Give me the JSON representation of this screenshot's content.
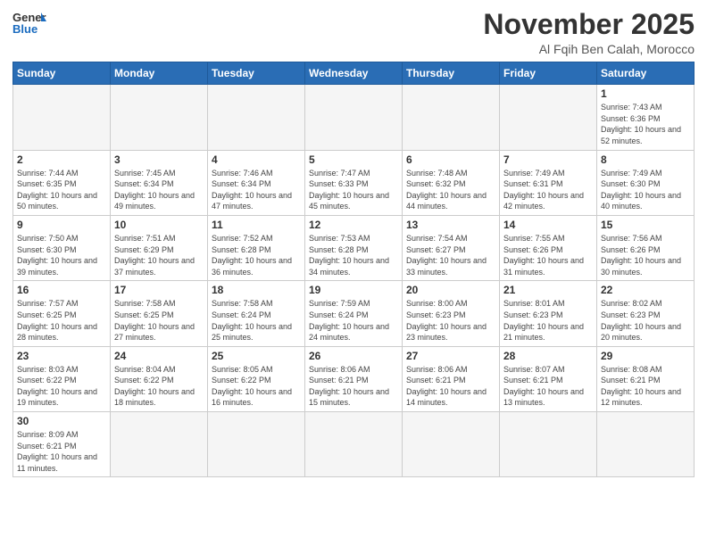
{
  "logo": {
    "text_general": "General",
    "text_blue": "Blue"
  },
  "header": {
    "title": "November 2025",
    "subtitle": "Al Fqih Ben Calah, Morocco"
  },
  "weekdays": [
    "Sunday",
    "Monday",
    "Tuesday",
    "Wednesday",
    "Thursday",
    "Friday",
    "Saturday"
  ],
  "weeks": [
    [
      {
        "day": "",
        "info": ""
      },
      {
        "day": "",
        "info": ""
      },
      {
        "day": "",
        "info": ""
      },
      {
        "day": "",
        "info": ""
      },
      {
        "day": "",
        "info": ""
      },
      {
        "day": "",
        "info": ""
      },
      {
        "day": "1",
        "info": "Sunrise: 7:43 AM\nSunset: 6:36 PM\nDaylight: 10 hours and 52 minutes."
      }
    ],
    [
      {
        "day": "2",
        "info": "Sunrise: 7:44 AM\nSunset: 6:35 PM\nDaylight: 10 hours and 50 minutes."
      },
      {
        "day": "3",
        "info": "Sunrise: 7:45 AM\nSunset: 6:34 PM\nDaylight: 10 hours and 49 minutes."
      },
      {
        "day": "4",
        "info": "Sunrise: 7:46 AM\nSunset: 6:34 PM\nDaylight: 10 hours and 47 minutes."
      },
      {
        "day": "5",
        "info": "Sunrise: 7:47 AM\nSunset: 6:33 PM\nDaylight: 10 hours and 45 minutes."
      },
      {
        "day": "6",
        "info": "Sunrise: 7:48 AM\nSunset: 6:32 PM\nDaylight: 10 hours and 44 minutes."
      },
      {
        "day": "7",
        "info": "Sunrise: 7:49 AM\nSunset: 6:31 PM\nDaylight: 10 hours and 42 minutes."
      },
      {
        "day": "8",
        "info": "Sunrise: 7:49 AM\nSunset: 6:30 PM\nDaylight: 10 hours and 40 minutes."
      }
    ],
    [
      {
        "day": "9",
        "info": "Sunrise: 7:50 AM\nSunset: 6:30 PM\nDaylight: 10 hours and 39 minutes."
      },
      {
        "day": "10",
        "info": "Sunrise: 7:51 AM\nSunset: 6:29 PM\nDaylight: 10 hours and 37 minutes."
      },
      {
        "day": "11",
        "info": "Sunrise: 7:52 AM\nSunset: 6:28 PM\nDaylight: 10 hours and 36 minutes."
      },
      {
        "day": "12",
        "info": "Sunrise: 7:53 AM\nSunset: 6:28 PM\nDaylight: 10 hours and 34 minutes."
      },
      {
        "day": "13",
        "info": "Sunrise: 7:54 AM\nSunset: 6:27 PM\nDaylight: 10 hours and 33 minutes."
      },
      {
        "day": "14",
        "info": "Sunrise: 7:55 AM\nSunset: 6:26 PM\nDaylight: 10 hours and 31 minutes."
      },
      {
        "day": "15",
        "info": "Sunrise: 7:56 AM\nSunset: 6:26 PM\nDaylight: 10 hours and 30 minutes."
      }
    ],
    [
      {
        "day": "16",
        "info": "Sunrise: 7:57 AM\nSunset: 6:25 PM\nDaylight: 10 hours and 28 minutes."
      },
      {
        "day": "17",
        "info": "Sunrise: 7:58 AM\nSunset: 6:25 PM\nDaylight: 10 hours and 27 minutes."
      },
      {
        "day": "18",
        "info": "Sunrise: 7:58 AM\nSunset: 6:24 PM\nDaylight: 10 hours and 25 minutes."
      },
      {
        "day": "19",
        "info": "Sunrise: 7:59 AM\nSunset: 6:24 PM\nDaylight: 10 hours and 24 minutes."
      },
      {
        "day": "20",
        "info": "Sunrise: 8:00 AM\nSunset: 6:23 PM\nDaylight: 10 hours and 23 minutes."
      },
      {
        "day": "21",
        "info": "Sunrise: 8:01 AM\nSunset: 6:23 PM\nDaylight: 10 hours and 21 minutes."
      },
      {
        "day": "22",
        "info": "Sunrise: 8:02 AM\nSunset: 6:23 PM\nDaylight: 10 hours and 20 minutes."
      }
    ],
    [
      {
        "day": "23",
        "info": "Sunrise: 8:03 AM\nSunset: 6:22 PM\nDaylight: 10 hours and 19 minutes."
      },
      {
        "day": "24",
        "info": "Sunrise: 8:04 AM\nSunset: 6:22 PM\nDaylight: 10 hours and 18 minutes."
      },
      {
        "day": "25",
        "info": "Sunrise: 8:05 AM\nSunset: 6:22 PM\nDaylight: 10 hours and 16 minutes."
      },
      {
        "day": "26",
        "info": "Sunrise: 8:06 AM\nSunset: 6:21 PM\nDaylight: 10 hours and 15 minutes."
      },
      {
        "day": "27",
        "info": "Sunrise: 8:06 AM\nSunset: 6:21 PM\nDaylight: 10 hours and 14 minutes."
      },
      {
        "day": "28",
        "info": "Sunrise: 8:07 AM\nSunset: 6:21 PM\nDaylight: 10 hours and 13 minutes."
      },
      {
        "day": "29",
        "info": "Sunrise: 8:08 AM\nSunset: 6:21 PM\nDaylight: 10 hours and 12 minutes."
      }
    ],
    [
      {
        "day": "30",
        "info": "Sunrise: 8:09 AM\nSunset: 6:21 PM\nDaylight: 10 hours and 11 minutes."
      },
      {
        "day": "",
        "info": ""
      },
      {
        "day": "",
        "info": ""
      },
      {
        "day": "",
        "info": ""
      },
      {
        "day": "",
        "info": ""
      },
      {
        "day": "",
        "info": ""
      },
      {
        "day": "",
        "info": ""
      }
    ]
  ]
}
